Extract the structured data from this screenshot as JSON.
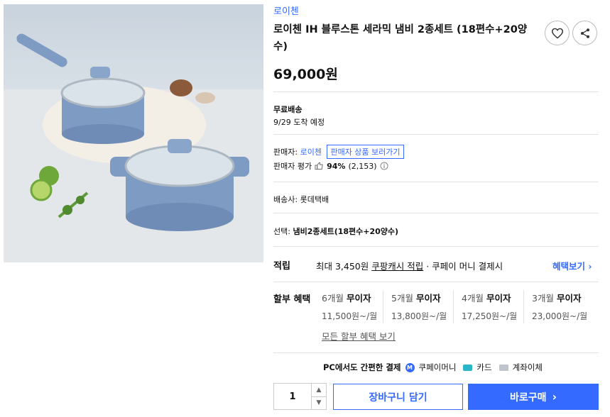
{
  "product": {
    "brand": "로이첸",
    "title": "로이첸 IH 블루스톤 세라믹 냄비 2종세트 (18편수+20양수)",
    "price": "69,000원"
  },
  "icons": {
    "wishlist": "heart-icon",
    "share": "share-icon"
  },
  "shipping": {
    "label": "무료배송",
    "eta": "9/29 도착 예정"
  },
  "seller": {
    "label": "판매자:",
    "name": "로이첸",
    "view_products": "판매자 상품 보러가기",
    "rating_label": "판매자 평가",
    "rating_pct": "94%",
    "rating_count": "(2,153)"
  },
  "courier": {
    "label": "배송사:",
    "name": "롯데택배"
  },
  "option": {
    "label": "선택:",
    "value": "냄비2종세트(18편수+20양수)"
  },
  "reward": {
    "label": "적립",
    "text_prefix": "최대 3,450원",
    "link": "쿠팡캐시 적립",
    "text_suffix": "· 쿠페이 머니 결제시",
    "benefit_link": "혜택보기"
  },
  "installment": {
    "label": "할부 혜택",
    "plans": [
      {
        "months": "6개월",
        "type": "무이자",
        "amount": "11,500원~/월"
      },
      {
        "months": "5개월",
        "type": "무이자",
        "amount": "13,800원~/월"
      },
      {
        "months": "4개월",
        "type": "무이자",
        "amount": "17,250원~/월"
      },
      {
        "months": "3개월",
        "type": "무이자",
        "amount": "23,000원~/월"
      }
    ],
    "all_link": "모든 할부 혜택 보기"
  },
  "payment": {
    "text": "PC에서도 간편한 결제",
    "methods": [
      "쿠페이머니",
      "카드",
      "계좌이체"
    ]
  },
  "purchase": {
    "quantity": "1",
    "cart": "장바구니 담기",
    "buy": "바로구매"
  },
  "colors": {
    "accent": "#346aff",
    "pot": "#7e9bc4"
  }
}
